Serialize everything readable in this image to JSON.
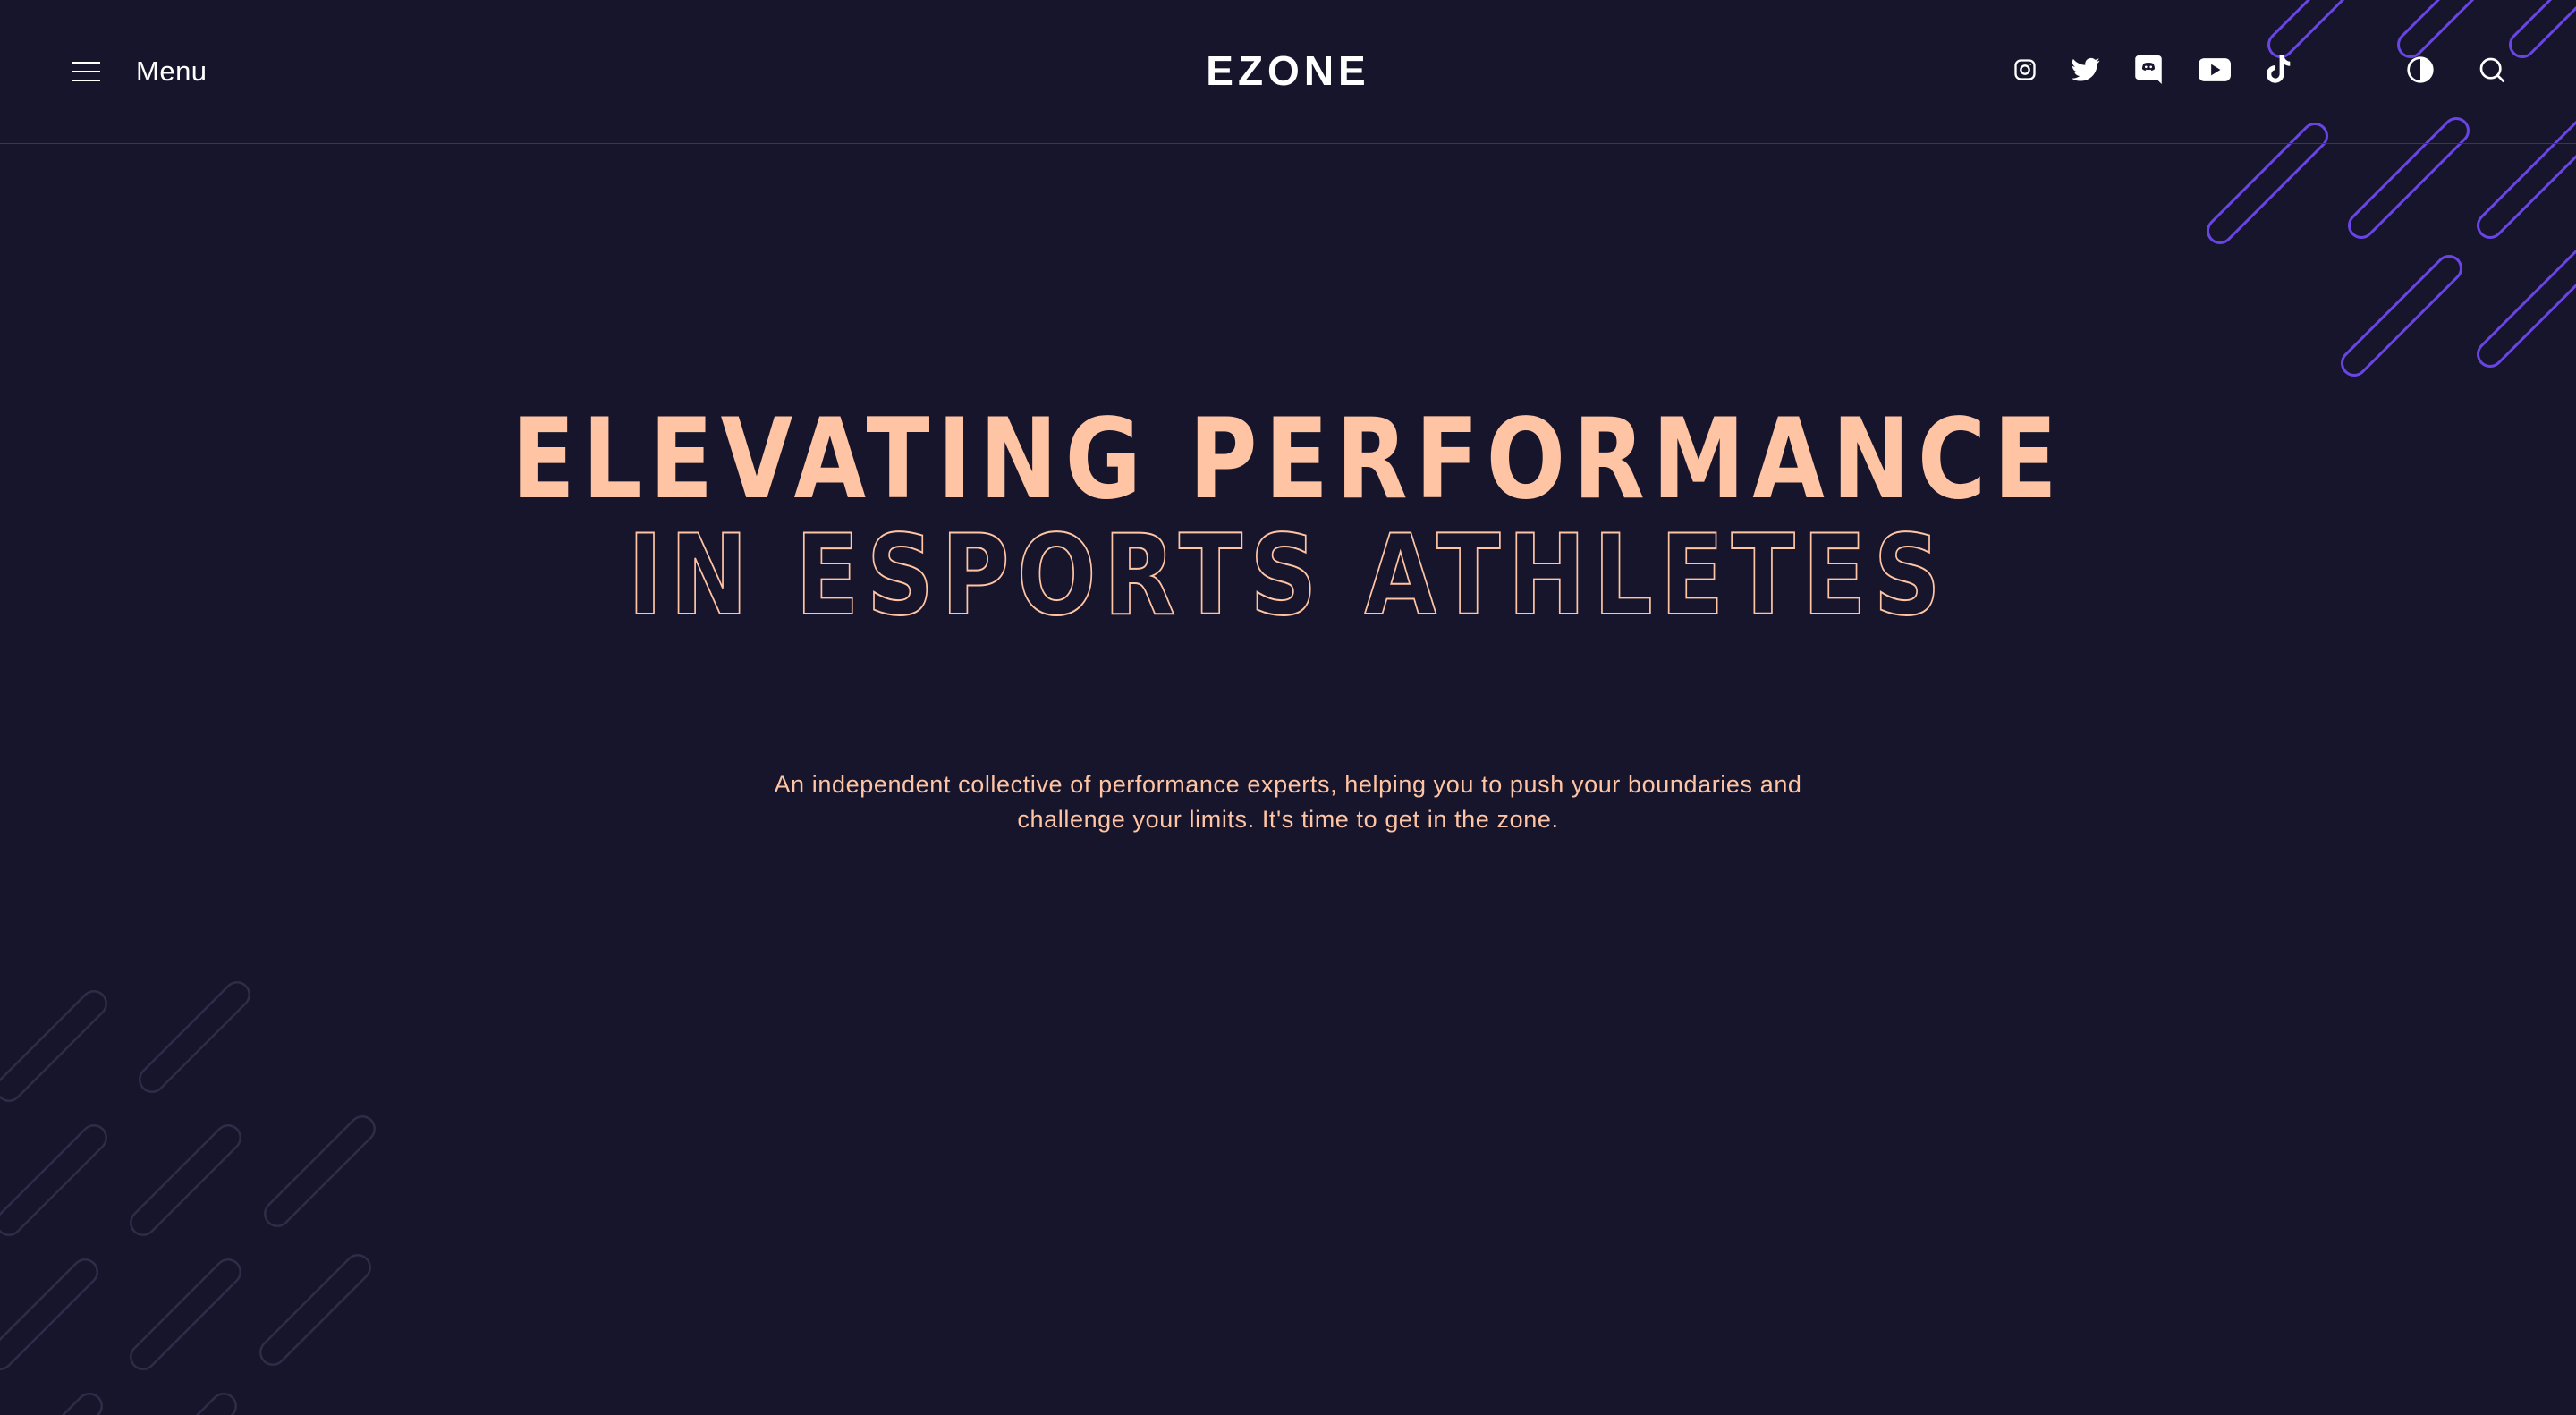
{
  "header": {
    "menu_label": "Menu",
    "logo_text": "EZONE",
    "social_icons": [
      "instagram-icon",
      "twitter-icon",
      "discord-icon",
      "youtube-icon",
      "tiktok-icon"
    ],
    "utility_icons": [
      "contrast-toggle-icon",
      "search-icon"
    ]
  },
  "hero": {
    "headline_line1": "ELEVATING PERFORMANCE",
    "headline_line2": "IN ESPORTS ATHLETES",
    "description_line1": "An independent collective of performance experts, helping you to push your boundaries and",
    "description_line2": "challenge your limits. It's time to get in the zone."
  },
  "colors": {
    "background": "#17152b",
    "accent_peach": "#ffc4a3",
    "accent_purple": "#6a45e6",
    "decor_muted": "#2e2c48",
    "header_text": "#ffffff"
  }
}
